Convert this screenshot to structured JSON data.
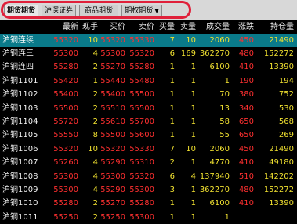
{
  "tabs": [
    {
      "label": "期货期货",
      "active": true
    },
    {
      "label": "沪深证券",
      "active": false
    },
    {
      "label": "商品期货",
      "active": false
    },
    {
      "label": "期权期货",
      "active": false,
      "dropdown": true
    }
  ],
  "columns": [
    "",
    "最新",
    "现手",
    "买价",
    "卖价",
    "买量",
    "卖量",
    "成交量",
    "涨跌",
    "持仓量"
  ],
  "selected_row": {
    "name": "沪铜连续",
    "last": "55320",
    "vol": "10",
    "bid": "55320",
    "ask": "55330",
    "bid_vol": "7",
    "ask_vol": "10",
    "volume": "2060",
    "change": "450",
    "oi": "21490"
  },
  "rows": [
    {
      "name": "沪铜连三",
      "last": "55300",
      "vol": "4",
      "bid": "55300",
      "ask": "55320",
      "bid_vol": "6",
      "ask_vol": "169",
      "volume": "362270",
      "change": "480",
      "oi": "152272"
    },
    {
      "name": "沪铜连四",
      "last": "55280",
      "vol": "2",
      "bid": "55270",
      "ask": "55280",
      "bid_vol": "1",
      "ask_vol": "1",
      "volume": "6100",
      "change": "410",
      "oi": "13390"
    },
    {
      "name": "沪铜1101",
      "last": "55420",
      "vol": "1",
      "bid": "55440",
      "ask": "55480",
      "bid_vol": "1",
      "ask_vol": "1",
      "volume": "1",
      "change": "190",
      "oi": "194"
    },
    {
      "name": "沪铜1102",
      "last": "55400",
      "vol": "2",
      "bid": "55400",
      "ask": "55500",
      "bid_vol": "1",
      "ask_vol": "1",
      "volume": "70",
      "change": "380",
      "oi": "752"
    },
    {
      "name": "沪铜1103",
      "last": "55500",
      "vol": "2",
      "bid": "55510",
      "ask": "55500",
      "bid_vol": "1",
      "ask_vol": "1",
      "volume": "13",
      "change": "340",
      "oi": "530"
    },
    {
      "name": "沪铜1104",
      "last": "55720",
      "vol": "2",
      "bid": "55610",
      "ask": "55700",
      "bid_vol": "1",
      "ask_vol": "1",
      "volume": "58",
      "change": "650",
      "oi": "568"
    },
    {
      "name": "沪铜1105",
      "last": "55550",
      "vol": "8",
      "bid": "55500",
      "ask": "55600",
      "bid_vol": "1",
      "ask_vol": "1",
      "volume": "55",
      "change": "650",
      "oi": "269"
    },
    {
      "name": "沪铜1006",
      "last": "55320",
      "vol": "10",
      "bid": "55320",
      "ask": "55330",
      "bid_vol": "7",
      "ask_vol": "10",
      "volume": "2060",
      "change": "450",
      "oi": "21490"
    },
    {
      "name": "沪铜1007",
      "last": "55260",
      "vol": "4",
      "bid": "55290",
      "ask": "55310",
      "bid_vol": "2",
      "ask_vol": "1",
      "volume": "4770",
      "change": "410",
      "oi": "49180"
    },
    {
      "name": "沪铜1008",
      "last": "55300",
      "vol": "4",
      "bid": "55300",
      "ask": "55320",
      "bid_vol": "6",
      "ask_vol": "4",
      "volume": "137940",
      "change": "510",
      "oi": "142202"
    },
    {
      "name": "沪铜1009",
      "last": "55300",
      "vol": "4",
      "bid": "55290",
      "ask": "55300",
      "bid_vol": "3",
      "ask_vol": "1",
      "volume": "362270",
      "change": "480",
      "oi": "152272"
    },
    {
      "name": "沪铜1010",
      "last": "55280",
      "vol": "2",
      "bid": "55270",
      "ask": "55280",
      "bid_vol": "1",
      "ask_vol": "1",
      "volume": "6100",
      "change": "410",
      "oi": "13390"
    },
    {
      "name": "沪铜1011",
      "last": "55250",
      "vol": "2",
      "bid": "55250",
      "ask": "55300",
      "bid_vol": "1",
      "ask_vol": "1",
      "volume": "1",
      "change": "",
      "oi": ""
    }
  ],
  "colors": {
    "background": "#000000",
    "selected_row": "#0a7a8a",
    "price_red": "#ff3030",
    "volume_yellow": "#f0e030",
    "highlight_oval": "#e0203a",
    "tabbar": "#d8d8d8"
  }
}
